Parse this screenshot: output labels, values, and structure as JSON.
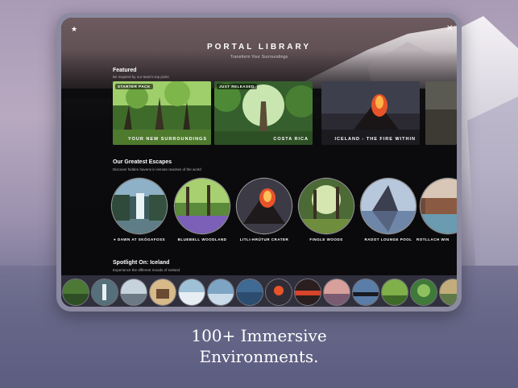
{
  "header": {
    "title": "PORTAL LIBRARY",
    "subtitle": "Transform Your Surroundings"
  },
  "featured": {
    "title": "Featured",
    "subtitle": "Be inspired by our team's top picks",
    "cards": [
      {
        "badge": "STARTER PACK",
        "label": "YOUR NEW SURROUNDINGS"
      },
      {
        "badge": "JUST RELEASED",
        "label": "COSTA RICA"
      },
      {
        "badge": "",
        "label": "ICELAND - THE FIRE WITHIN"
      }
    ]
  },
  "escapes": {
    "title": "Our Greatest Escapes",
    "subtitle": "Discover hidden havens in remote reaches of the world",
    "items": [
      {
        "label": "DAWN AT SKÓGAFOSS"
      },
      {
        "label": "BLUEBELL WOODLAND"
      },
      {
        "label": "LITLI-HRÚTUR CRATER"
      },
      {
        "label": "FINGLE WOODS"
      },
      {
        "label": "RADOT LOUNGE POOL"
      },
      {
        "label": "ROTLLACH WIN"
      }
    ]
  },
  "spotlight": {
    "title": "Spotlight On: Iceland",
    "subtitle": "Experience the different moods of Iceland"
  },
  "tagline": {
    "line1": "100+ Immersive",
    "line2": "Environments."
  },
  "colors": {
    "accent": "#ffffff",
    "background": "#0b0b0d",
    "lava": "#e8542a"
  },
  "icons": {
    "favorite": "star-icon",
    "close": "close-icon",
    "featured_on_item": "dot-icon"
  }
}
